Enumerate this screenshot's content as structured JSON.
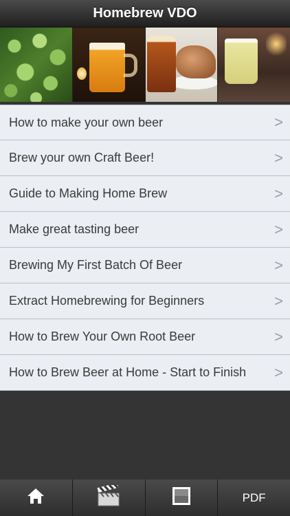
{
  "nav": {
    "title": "Homebrew VDO"
  },
  "banner": {
    "photos": [
      "hops-photo",
      "beer-mug-photo",
      "pint-and-bread-photo",
      "pale-beer-photo"
    ]
  },
  "list": {
    "items": [
      {
        "label": "How to make your own beer"
      },
      {
        "label": "Brew your own Craft Beer!"
      },
      {
        "label": "Guide to Making Home Brew"
      },
      {
        "label": "Make great tasting beer"
      },
      {
        "label": "Brewing My First Batch Of Beer"
      },
      {
        "label": "Extract Homebrewing for Beginners"
      },
      {
        "label": "How to Brew Your Own Root Beer"
      },
      {
        "label": "How to Brew Beer at Home - Start to Finish"
      }
    ],
    "chevron": ">"
  },
  "tabbar": {
    "tabs": [
      {
        "icon": "home-icon"
      },
      {
        "icon": "clapperboard-icon"
      },
      {
        "icon": "square-icon"
      },
      {
        "label": "PDF"
      }
    ]
  },
  "colors": {
    "list_background": "#ebeef2",
    "separator": "#b9bec6",
    "chrome_dark": "#343434"
  }
}
